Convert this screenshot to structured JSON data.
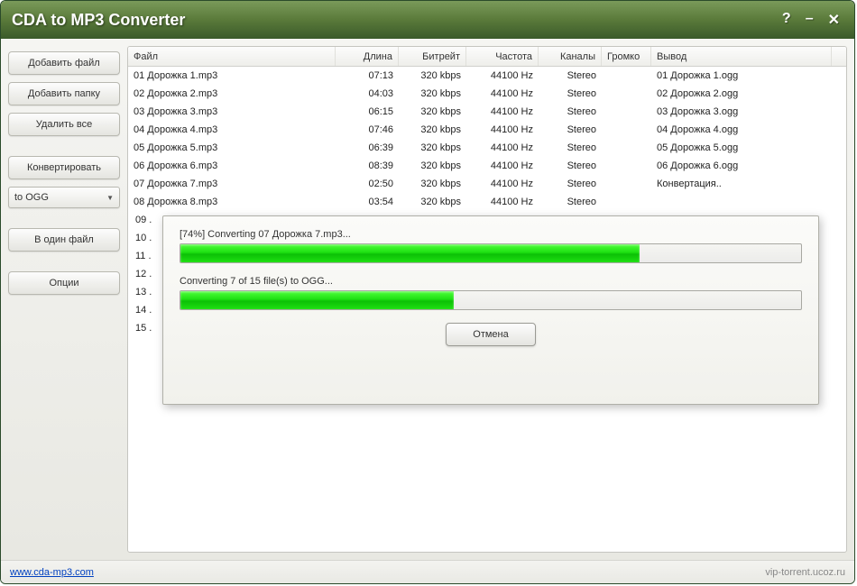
{
  "title": "CDA to MP3 Converter",
  "window_controls": {
    "help": "?",
    "min": "–",
    "close": "✕"
  },
  "sidebar": {
    "add_file": "Добавить файл",
    "add_folder": "Добавить папку",
    "remove_all": "Удалить все",
    "convert": "Конвертировать",
    "format_select": "to OGG",
    "one_file": "В один файл",
    "options": "Опции"
  },
  "columns": {
    "file": "Файл",
    "length": "Длина",
    "bitrate": "Битрейт",
    "freq": "Частота",
    "channels": "Каналы",
    "volume": "Громко",
    "output": "Вывод"
  },
  "rows": [
    {
      "file": "01 Дорожка 1.mp3",
      "len": "07:13",
      "bit": "320 kbps",
      "freq": "44100 Hz",
      "ch": "Stereo",
      "vol": "",
      "out": "01 Дорожка 1.ogg"
    },
    {
      "file": "02 Дорожка 2.mp3",
      "len": "04:03",
      "bit": "320 kbps",
      "freq": "44100 Hz",
      "ch": "Stereo",
      "vol": "",
      "out": "02 Дорожка 2.ogg"
    },
    {
      "file": "03 Дорожка 3.mp3",
      "len": "06:15",
      "bit": "320 kbps",
      "freq": "44100 Hz",
      "ch": "Stereo",
      "vol": "",
      "out": "03 Дорожка 3.ogg"
    },
    {
      "file": "04 Дорожка 4.mp3",
      "len": "07:46",
      "bit": "320 kbps",
      "freq": "44100 Hz",
      "ch": "Stereo",
      "vol": "",
      "out": "04 Дорожка 4.ogg"
    },
    {
      "file": "05 Дорожка 5.mp3",
      "len": "06:39",
      "bit": "320 kbps",
      "freq": "44100 Hz",
      "ch": "Stereo",
      "vol": "",
      "out": "05 Дорожка 5.ogg"
    },
    {
      "file": "06 Дорожка 6.mp3",
      "len": "08:39",
      "bit": "320 kbps",
      "freq": "44100 Hz",
      "ch": "Stereo",
      "vol": "",
      "out": "06 Дорожка 6.ogg"
    },
    {
      "file": "07 Дорожка 7.mp3",
      "len": "02:50",
      "bit": "320 kbps",
      "freq": "44100 Hz",
      "ch": "Stereo",
      "vol": "",
      "out": "Конвертация.."
    },
    {
      "file": "08 Дорожка 8.mp3",
      "len": "03:54",
      "bit": "320 kbps",
      "freq": "44100 Hz",
      "ch": "Stereo",
      "vol": "",
      "out": ""
    }
  ],
  "extra_rows": [
    "09 .",
    "10 .",
    "11 .",
    "12 .",
    "13 .",
    "14 .",
    "15 ."
  ],
  "dialog": {
    "line1": "[74%] Converting 07 Дорожка 7.mp3...",
    "progress1": 74,
    "line2": "Converting 7 of 15 file(s) to OGG...",
    "progress2": 44,
    "cancel": "Отмена"
  },
  "footer": {
    "link_text": "www.cda-mp3.com",
    "watermark": "vip-torrent.ucoz.ru"
  }
}
